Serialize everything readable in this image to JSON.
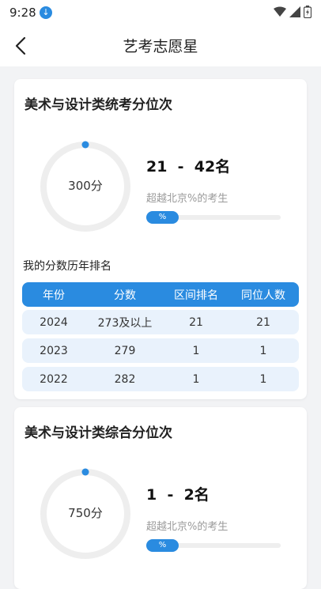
{
  "status_bar": {
    "time": "9:28"
  },
  "app_bar": {
    "title": "艺考志愿星"
  },
  "cards": [
    {
      "title": "美术与设计类统考分位次",
      "score": "300分",
      "rank_text": "21  -  42名",
      "exceed_text": "超越北京%的考生",
      "progress_label": "%",
      "ring_progress": 0.0,
      "history_label": "我的分数历年排名",
      "table": {
        "headers": [
          "年份",
          "分数",
          "区间排名",
          "同位人数"
        ],
        "rows": [
          [
            "2024",
            "273及以上",
            "21",
            "21"
          ],
          [
            "2023",
            "279",
            "1",
            "1"
          ],
          [
            "2022",
            "282",
            "1",
            "1"
          ]
        ]
      }
    },
    {
      "title": "美术与设计类综合分位次",
      "score": "750分",
      "rank_text": "1  -  2名",
      "exceed_text": "超越北京%的考生",
      "progress_label": "%",
      "ring_progress": 0.0
    }
  ],
  "colors": {
    "accent": "#2a8be0",
    "ring_track": "#eeeeee",
    "row_bg": "#e9f2fc"
  }
}
